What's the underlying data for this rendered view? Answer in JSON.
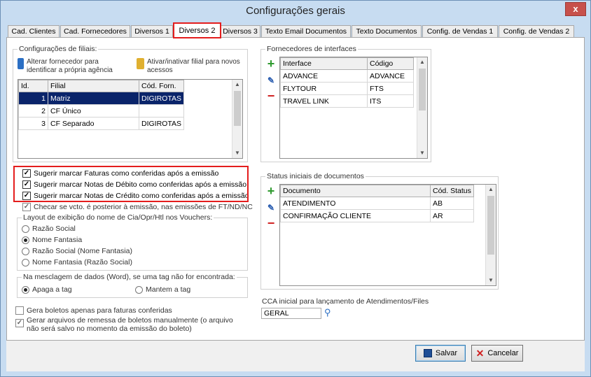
{
  "window": {
    "title": "Configurações gerais",
    "close_label": "x"
  },
  "tabs": [
    {
      "label": "Cad. Clientes"
    },
    {
      "label": "Cad. Fornecedores"
    },
    {
      "label": "Diversos 1"
    },
    {
      "label": "Diversos 2"
    },
    {
      "label": "Diversos 3"
    },
    {
      "label": "Texto Email Documentos"
    },
    {
      "label": "Texto Documentos"
    },
    {
      "label": "Config. de Vendas 1"
    },
    {
      "label": "Config. de Vendas 2"
    }
  ],
  "filiais": {
    "group_title": "Configurações de filiais:",
    "btn_alterar": "Alterar fornecedor para identificar a própria agência",
    "btn_ativar": "Ativar/inativar filial para novos acessos",
    "columns": [
      "Id.",
      "Filial",
      "Cód. Forn."
    ],
    "rows": [
      {
        "id": "1",
        "filial": "Matriz",
        "cod": "DIGIROTAS"
      },
      {
        "id": "2",
        "filial": "CF Único",
        "cod": ""
      },
      {
        "id": "3",
        "filial": "CF Separado",
        "cod": "DIGIROTAS"
      }
    ]
  },
  "checks": {
    "faturas": "Sugerir marcar Faturas como conferidas após a emissão",
    "debito": "Sugerir marcar Notas de Débito como conferidas após a emissão",
    "credito": "Sugerir marcar Notas de Crédito como conferidas após a emissão",
    "checar": "Checar se vcto. é posterior à emissão, nas emissões de FT/ND/NC"
  },
  "layout": {
    "group_title": "Layout de exibição do nome de Cia/Opr/Htl nos Vouchers:",
    "options": [
      "Razão Social",
      "Nome Fantasia",
      "Razão Social (Nome Fantasia)",
      "Nome Fantasia (Razão Social)"
    ],
    "selected_label": "Nome Fantasia"
  },
  "mesclagem": {
    "group_title": "Na mesclagem de dados (Word), se uma tag não for encontrada:",
    "opt_apaga": "Apaga a tag",
    "opt_mantem": "Mantem a tag"
  },
  "boletos": {
    "gera_apenas": "Gera boletos apenas para faturas conferidas",
    "gerar_remessa": "Gerar arquivos de remessa de boletos manualmente (o arquivo não será salvo no momento da emissão do boleto)"
  },
  "fornecedores": {
    "group_title": "Fornecedores de interfaces",
    "columns": [
      "Interface",
      "Código"
    ],
    "rows": [
      {
        "interface": "ADVANCE",
        "codigo": "ADVANCE"
      },
      {
        "interface": "FLYTOUR",
        "codigo": "FTS"
      },
      {
        "interface": "TRAVEL LINK",
        "codigo": "ITS"
      }
    ]
  },
  "status": {
    "group_title": "Status iniciais de documentos",
    "columns": [
      "Documento",
      "Cód. Status"
    ],
    "rows": [
      {
        "documento": "ATENDIMENTO",
        "codigo": "AB"
      },
      {
        "documento": "CONFIRMAÇÃO CLIENTE",
        "codigo": "AR"
      }
    ]
  },
  "cca": {
    "label": "CCA inicial para lançamento de Atendimentos/Files",
    "value": "GERAL"
  },
  "footer": {
    "save_label": "Salvar",
    "cancel_label": "Cancelar"
  },
  "colors": {
    "highlight": "#e41d1d",
    "selection": "#0a246a"
  }
}
